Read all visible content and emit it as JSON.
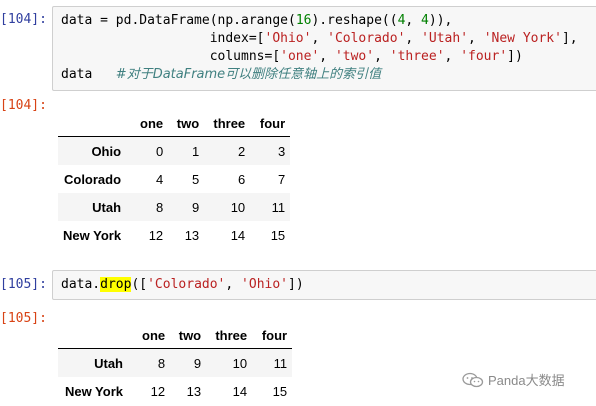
{
  "cell1": {
    "in_prompt": "[104]:",
    "out_prompt": "[104]:",
    "line1_a": "data = pd.DataFrame(np.arange(",
    "line1_num": "16",
    "line1_b": ").reshape((",
    "line1_n1": "4",
    "line1_c": ", ",
    "line1_n2": "4",
    "line1_d": ")),",
    "line2_pre": "                   index=[",
    "line2_s1": "'Ohio'",
    "line2_s2": "'Colorado'",
    "line2_s3": "'Utah'",
    "line2_s4": "'New York'",
    "line2_end": "],",
    "line3_pre": "                   columns=[",
    "line3_s1": "'one'",
    "line3_s2": "'two'",
    "line3_s3": "'three'",
    "line3_s4": "'four'",
    "line3_end": "])",
    "line4_code": "data   ",
    "line4_comment": "#对于DataFrame可以删除任意轴上的索引值",
    "sep": ", "
  },
  "table1": {
    "columns": [
      "one",
      "two",
      "three",
      "four"
    ],
    "rows": [
      {
        "label": "Ohio",
        "values": [
          "0",
          "1",
          "2",
          "3"
        ]
      },
      {
        "label": "Colorado",
        "values": [
          "4",
          "5",
          "6",
          "7"
        ]
      },
      {
        "label": "Utah",
        "values": [
          "8",
          "9",
          "10",
          "11"
        ]
      },
      {
        "label": "New York",
        "values": [
          "12",
          "13",
          "14",
          "15"
        ]
      }
    ]
  },
  "cell2": {
    "in_prompt": "[105]:",
    "out_prompt": "[105]:",
    "code_a": "data.",
    "code_hl": "drop",
    "code_b": "([",
    "code_s1": "'Colorado'",
    "code_sep": ", ",
    "code_s2": "'Ohio'",
    "code_c": "])"
  },
  "table2": {
    "columns": [
      "one",
      "two",
      "three",
      "four"
    ],
    "rows": [
      {
        "label": "Utah",
        "values": [
          "8",
          "9",
          "10",
          "11"
        ]
      },
      {
        "label": "New York",
        "values": [
          "12",
          "13",
          "14",
          "15"
        ]
      }
    ]
  },
  "watermark": {
    "text": "Panda大数据",
    "icon": "wechat-icon"
  },
  "colors": {
    "in_prompt": "#303f9f",
    "out_prompt": "#d84315",
    "string": "#ba2121",
    "number": "#008000",
    "comment": "#408080",
    "highlight": "#ffff00"
  }
}
